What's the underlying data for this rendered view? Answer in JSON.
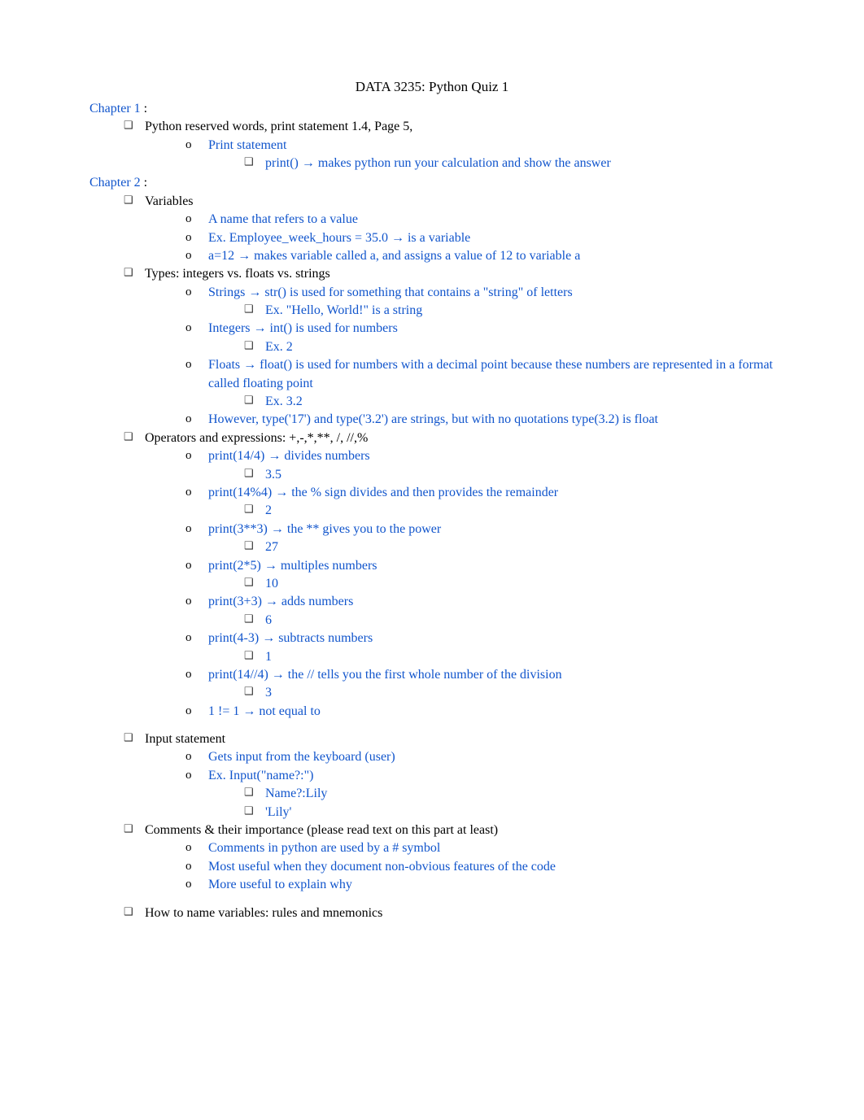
{
  "title": "DATA 3235: Python Quiz 1",
  "chapter1": {
    "heading": "Chapter 1",
    "colon": " :",
    "b1": "Python reserved words, print statement 1.4, Page 5,",
    "b1a": "Print statement",
    "b1a1": "print() → makes python run your calculation and show the answer"
  },
  "chapter2": {
    "heading": "Chapter 2",
    "colon": " :",
    "b1": "Variables",
    "b1a": "A name that refers to a value",
    "b1b": "Ex. Employee_week_hours = 35.0 → is a variable",
    "b1c": "a=12 → makes variable called a, and assigns a value of 12 to variable a",
    "b2": "Types: integers vs. floats vs. strings",
    "b2a": "Strings → str() is used for something that contains a \"string\" of letters",
    "b2a1": "Ex. \"Hello, World!\" is a string",
    "b2b": "Integers → int() is used for numbers",
    "b2b1": "Ex. 2",
    "b2c": "Floats → float() is used for numbers with a decimal point because these numbers are represented in a format called floating point",
    "b2c1": "Ex. 3.2",
    "b2d": "However, type('17') and type('3.2') are strings, but with no quotations type(3.2) is float",
    "b3": "Operators and expressions: +,-,*,**, /, //,%",
    "b3a": "print(14/4) → divides numbers",
    "b3a1": "3.5",
    "b3b": "print(14%4) → the % sign divides and then provides the remainder",
    "b3b1": "2",
    "b3c": "print(3**3) → the ** gives you to the power",
    "b3c1": "27",
    "b3d": "print(2*5) → multiples numbers",
    "b3d1": "10",
    "b3e": "print(3+3) → adds numbers",
    "b3e1": "6",
    "b3f": "print(4-3) → subtracts numbers",
    "b3f1": "1",
    "b3g": "print(14//4) → the // tells you the first whole number of the division",
    "b3g1": "3",
    "b3h": "1 != 1 → not equal to",
    "b4": "Input statement",
    "b4a": "Gets input from the keyboard (user)",
    "b4b": "Ex. Input(\"name?:\")",
    "b4b1": "Name?:Lily",
    "b4b2": "'Lily'",
    "b5": "Comments & their importance (please read text on this part at least)",
    "b5a": "Comments in python are used by a # symbol",
    "b5b": "Most useful when they document non-obvious features of the code",
    "b5c": "More useful to explain why",
    "b6": "How to name variables: rules and mnemonics"
  }
}
